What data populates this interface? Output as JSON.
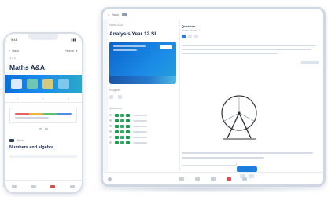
{
  "phone": {
    "status_time": "9:41",
    "nav_back": "Back",
    "nav_home": "Home",
    "subtoggle": "1 / 2",
    "title": "Maths A&A",
    "section_label": "Topic",
    "section_title": "Numbers and algebra"
  },
  "tablet": {
    "topbar_label": "Back",
    "breadcrumb": "Maths A&A",
    "side_title": "Analysis Year 12 SL",
    "sub_label": "Progress",
    "list_header": "Questions",
    "question_title": "Question 1",
    "question_sub": "Ferris wheel"
  },
  "colors": {
    "accent_blue": "#1c7fe0",
    "success_green": "#27b05d",
    "alert_red": "#d94d4d"
  }
}
